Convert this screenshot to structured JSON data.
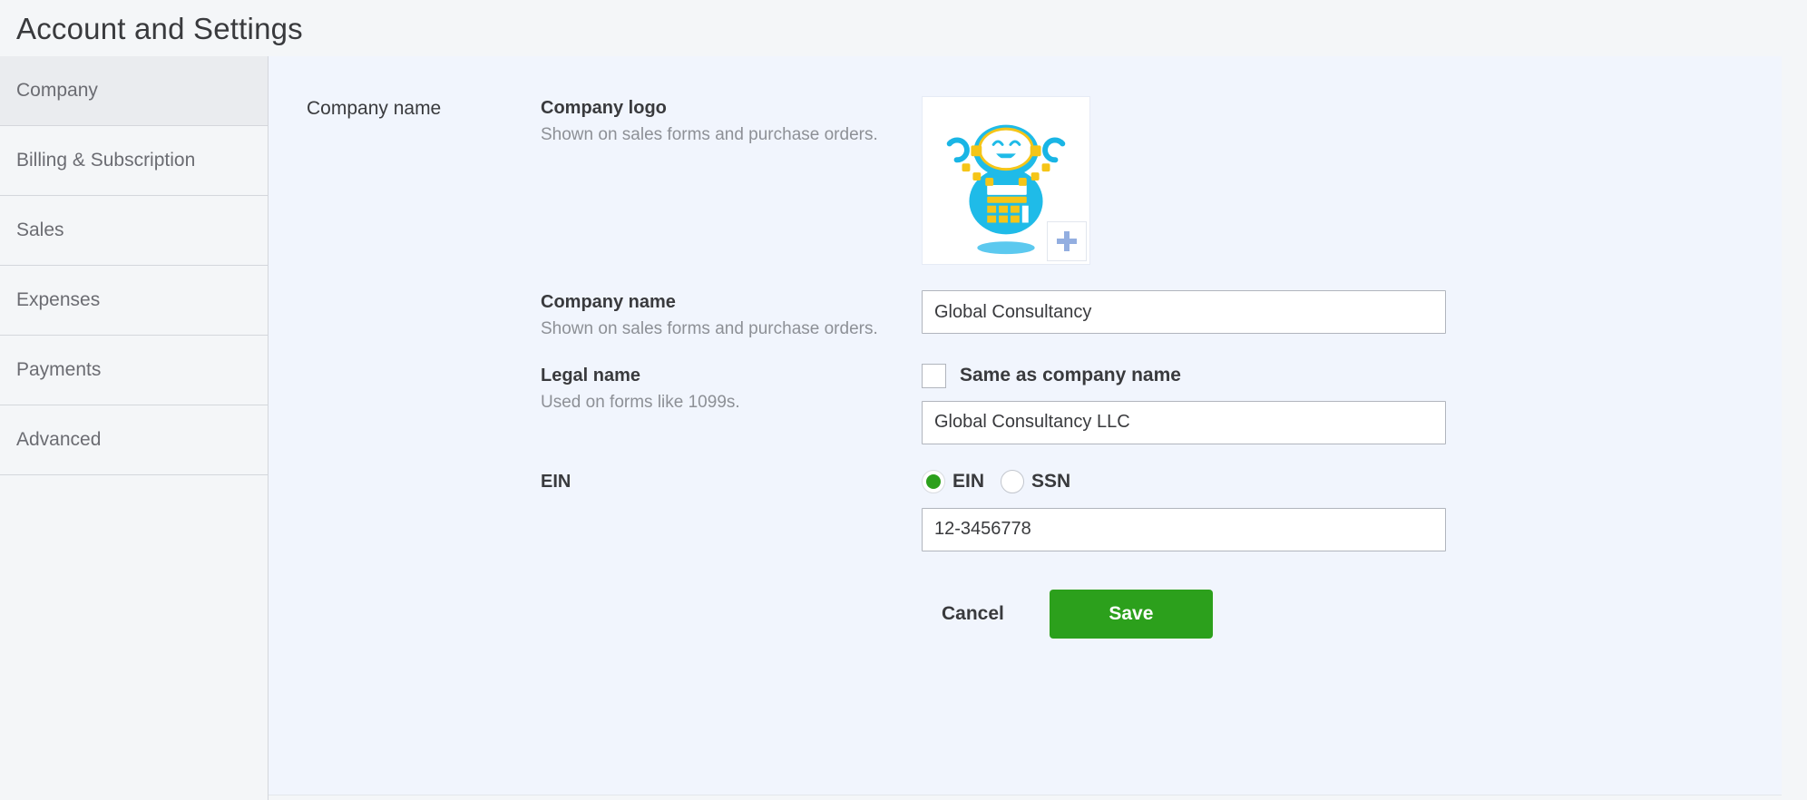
{
  "header": {
    "title": "Account and Settings"
  },
  "sidebar": {
    "items": [
      {
        "label": "Company",
        "active": true
      },
      {
        "label": "Billing & Subscription",
        "active": false
      },
      {
        "label": "Sales",
        "active": false
      },
      {
        "label": "Expenses",
        "active": false
      },
      {
        "label": "Payments",
        "active": false
      },
      {
        "label": "Advanced",
        "active": false
      }
    ]
  },
  "main": {
    "section_label": "Company name",
    "logo": {
      "title": "Company logo",
      "subtitle": "Shown on sales forms and purchase orders.",
      "add_icon": "plus-icon",
      "alt": "company-mascot-logo"
    },
    "company_name": {
      "title": "Company name",
      "subtitle": "Shown on sales forms and purchase orders.",
      "value": "Global Consultancy",
      "placeholder": "Company name"
    },
    "legal_name": {
      "title": "Legal name",
      "subtitle": "Used on forms like 1099s.",
      "checkbox_label": "Same as company name",
      "checkbox_checked": false,
      "value": "Global Consultancy LLC",
      "placeholder": "Legal name"
    },
    "ein": {
      "title": "EIN",
      "options": [
        {
          "label": "EIN",
          "selected": true
        },
        {
          "label": "SSN",
          "selected": false
        }
      ],
      "value": "12-3456778",
      "placeholder": "EIN"
    },
    "actions": {
      "cancel_label": "Cancel",
      "save_label": "Save"
    }
  },
  "colors": {
    "accent_green": "#2ca01c",
    "page_bg": "#f4f6f8",
    "panel_bg": "#f1f5fd",
    "sidebar_active": "#eaecef",
    "text_primary": "#393a3d",
    "text_muted": "#8d9096"
  }
}
